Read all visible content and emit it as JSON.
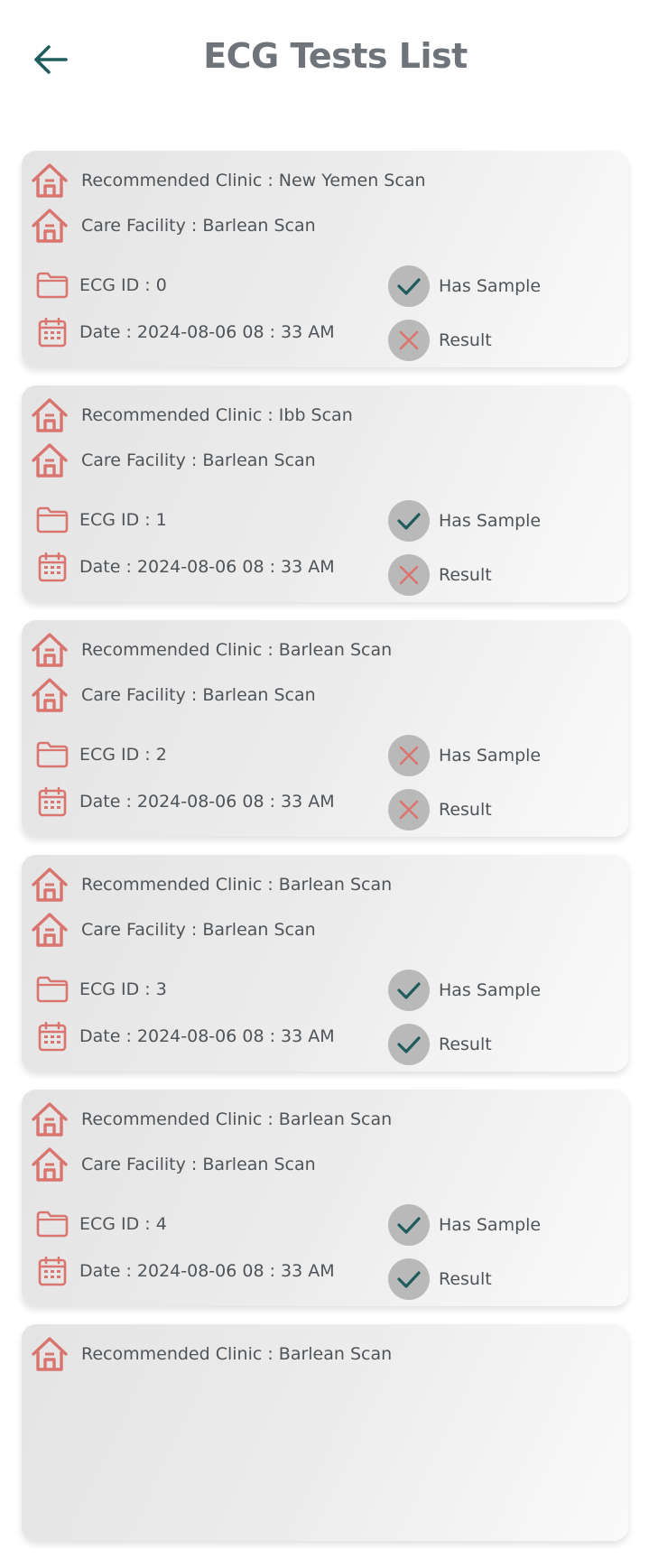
{
  "header": {
    "title": "ECG Tests List",
    "back_icon": "arrow-left-icon"
  },
  "colors": {
    "accent_teal": "#1f5c5c",
    "icon_red": "#d9756e",
    "title_gray": "#6e7479",
    "status_circle": "#b9b9b9"
  },
  "tests": [
    {
      "clinic": "Recommended Clinic : New Yemen Scan",
      "facility": "Care Facility : Barlean Scan",
      "ecg_id": "ECG ID : 0",
      "date": "Date : 2024-08-06  08 : 33 AM",
      "has_sample_label": "Has Sample",
      "has_sample": true,
      "result_label": "Result",
      "result": false
    },
    {
      "clinic": "Recommended Clinic : Ibb Scan",
      "facility": "Care Facility : Barlean Scan",
      "ecg_id": "ECG ID : 1",
      "date": "Date : 2024-08-06  08 : 33 AM",
      "has_sample_label": "Has Sample",
      "has_sample": true,
      "result_label": "Result",
      "result": false
    },
    {
      "clinic": "Recommended Clinic : Barlean Scan",
      "facility": "Care Facility : Barlean Scan",
      "ecg_id": "ECG ID : 2",
      "date": "Date : 2024-08-06  08 : 33 AM",
      "has_sample_label": "Has Sample",
      "has_sample": false,
      "result_label": "Result",
      "result": false
    },
    {
      "clinic": "Recommended Clinic : Barlean Scan",
      "facility": "Care Facility : Barlean Scan",
      "ecg_id": "ECG ID : 3",
      "date": "Date : 2024-08-06  08 : 33 AM",
      "has_sample_label": "Has Sample",
      "has_sample": true,
      "result_label": "Result",
      "result": true
    },
    {
      "clinic": "Recommended Clinic : Barlean Scan",
      "facility": "Care Facility : Barlean Scan",
      "ecg_id": "ECG ID : 4",
      "date": "Date : 2024-08-06  08 : 33 AM",
      "has_sample_label": "Has Sample",
      "has_sample": true,
      "result_label": "Result",
      "result": true
    },
    {
      "clinic": "Recommended Clinic : Barlean Scan",
      "facility": "",
      "ecg_id": "",
      "date": "",
      "has_sample_label": "",
      "has_sample": null,
      "result_label": "",
      "result": null
    }
  ]
}
